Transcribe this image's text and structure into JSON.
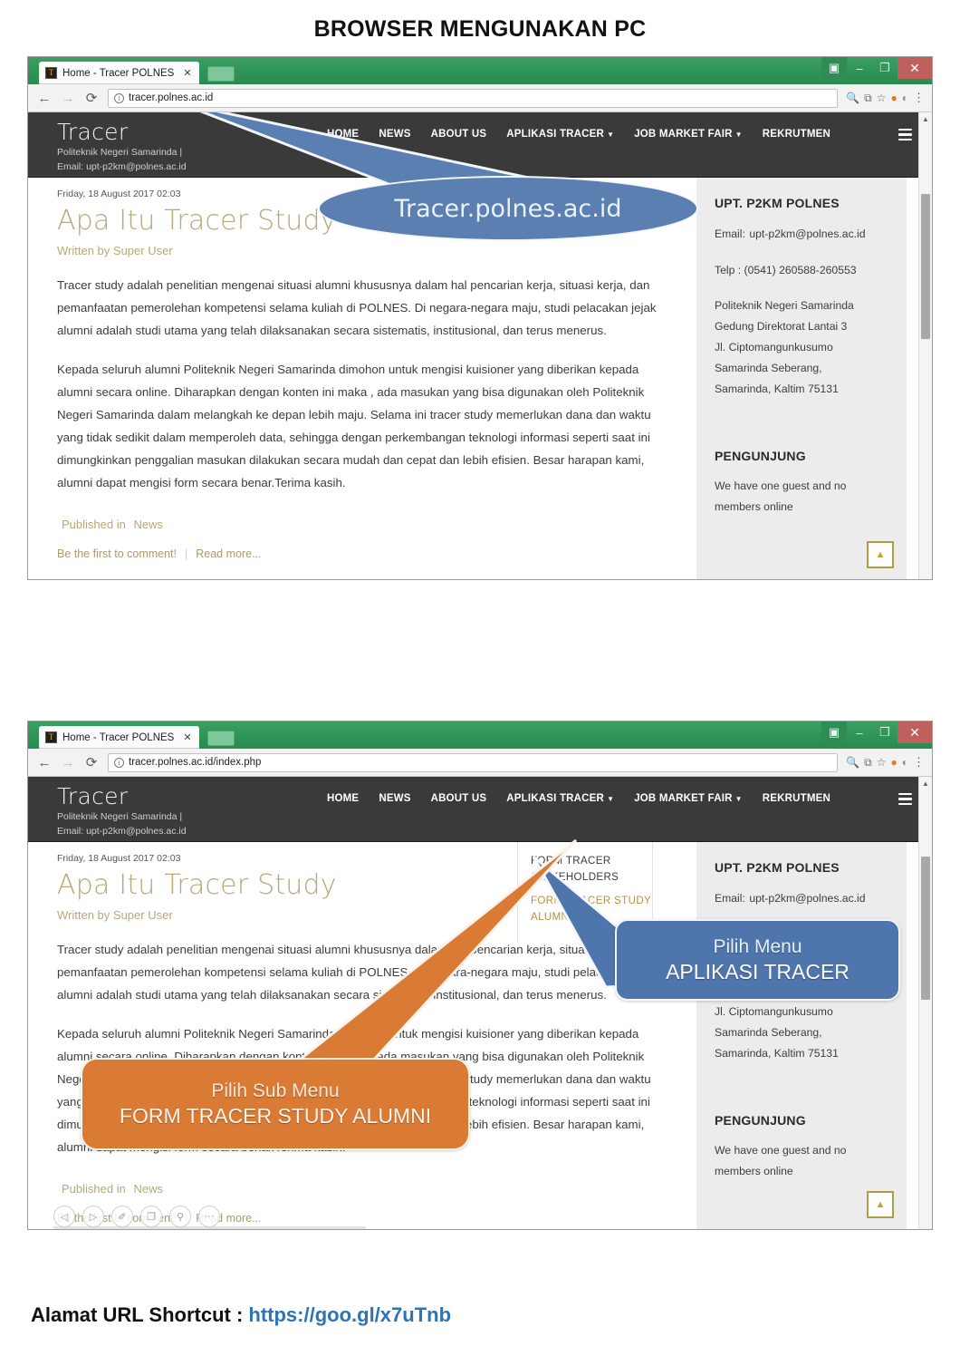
{
  "page": {
    "heading": "BROWSER MENGUNAKAN PC",
    "footer_label": "Alamat URL Shortcut : ",
    "footer_url": "https://goo.gl/x7uTnb"
  },
  "colors": {
    "titlebar_green": "#2e9456",
    "close_red": "#c0605e",
    "site_header_dark": "#3a3a3a",
    "accent_gold": "#b6a878",
    "callout_blue": "#5b7fb0",
    "callout_blue_dark": "#4e76ad",
    "callout_orange": "#d97b35",
    "link_blue": "#2e74b5"
  },
  "browser_chrome": {
    "tab_title": "Home - Tracer POLNES",
    "tab_close": "✕",
    "favicon_glyph": "T",
    "back_icon": "←",
    "forward_icon": "→",
    "reload_icon": "⟳",
    "info_icon": "i",
    "window_person": "▣",
    "window_minimize": "–",
    "window_maximize": "❐",
    "window_close": "✕",
    "toolbar_icons": [
      "🔍",
      "⧉",
      "☆",
      "●",
      "◐",
      "⋮"
    ]
  },
  "shot1": {
    "url": "tracer.polnes.ac.id"
  },
  "shot2": {
    "url": "tracer.polnes.ac.id/index.php"
  },
  "site": {
    "brand_name": "Tracer",
    "brand_sub_line1": "Politeknik Negeri Samarinda |",
    "brand_sub_line2": "Email: upt-p2km@polnes.ac.id",
    "nav": [
      {
        "label": "HOME",
        "caret": false
      },
      {
        "label": "NEWS",
        "caret": false
      },
      {
        "label": "ABOUT US",
        "caret": false
      },
      {
        "label": "APLIKASI TRACER",
        "caret": true
      },
      {
        "label": "JOB MARKET FAIR",
        "caret": true
      },
      {
        "label": "REKRUTMEN",
        "caret": false
      }
    ],
    "dropdown": [
      {
        "label": "FORM TRACER STAKEHOLDERS",
        "active": false
      },
      {
        "label": "FORM TRACER STUDY ALUMNI",
        "active": true
      }
    ]
  },
  "article": {
    "datestamp": "Friday, 18 August 2017 02:03",
    "title": "Apa Itu Tracer Study",
    "written_by_label": "Written by",
    "written_by_name": "Super User",
    "para1": "Tracer study adalah penelitian mengenai situasi alumni khususnya dalam hal pencarian kerja, situasi kerja, dan pemanfaatan pemerolehan kompetensi selama kuliah di POLNES. Di negara-negara maju, studi pelacakan jejak alumni adalah studi utama yang telah dilaksanakan secara sistematis, institusional, dan terus menerus.",
    "para2": "Kepada seluruh alumni Politeknik Negeri Samarinda dimohon untuk mengisi kuisioner yang diberikan kepada alumni secara online. Diharapkan dengan konten ini maka , ada masukan yang bisa digunakan oleh Politeknik Negeri Samarinda dalam melangkah ke depan lebih maju. Selama ini tracer study memerlukan dana dan waktu yang tidak sedikit dalam memperoleh data, sehingga dengan perkembangan teknologi informasi seperti saat ini dimungkinkan penggalian masukan dilakukan secara mudah dan cepat dan lebih efisien. Besar harapan kami, alumni dapat mengisi form secara benar.Terima kasih.",
    "published_label": "Published in",
    "published_category": "News",
    "comment_link": "Be the first to comment!",
    "separator": "|",
    "read_more": "Read more..."
  },
  "sidebar": {
    "heading": "UPT. P2KM POLNES",
    "email_label": "Email:",
    "email_value": "upt-p2km@polnes.ac.id",
    "telp": "Telp : (0541) 260588-260553",
    "address": [
      "Politeknik Negeri Samarinda",
      "Gedung Direktorat Lantai 3",
      "Jl. Ciptomangunkusumo",
      "Samarinda Seberang,",
      "Samarinda, Kaltim 75131"
    ],
    "visitor_heading": "PENGUNJUNG",
    "visitor_text": "We have one guest and no members online",
    "scroll_top_icon": "▲"
  },
  "callouts": {
    "url_bubble": "Tracer.polnes.ac.id",
    "menu_bubble_line1": "Pilih Menu",
    "menu_bubble_line2": "APLIKASI TRACER",
    "submenu_bubble_line1": "Pilih Sub Menu",
    "submenu_bubble_line2": "FORM TRACER STUDY ALUMNI"
  },
  "pdf_toolbar": {
    "buttons": [
      {
        "name": "previous-page",
        "glyph": "◁"
      },
      {
        "name": "next-page",
        "glyph": "▷"
      },
      {
        "name": "annotate",
        "glyph": "✐"
      },
      {
        "name": "copy",
        "glyph": "❐"
      },
      {
        "name": "search",
        "glyph": "⚲"
      },
      {
        "name": "more-options",
        "glyph": "···"
      }
    ]
  }
}
